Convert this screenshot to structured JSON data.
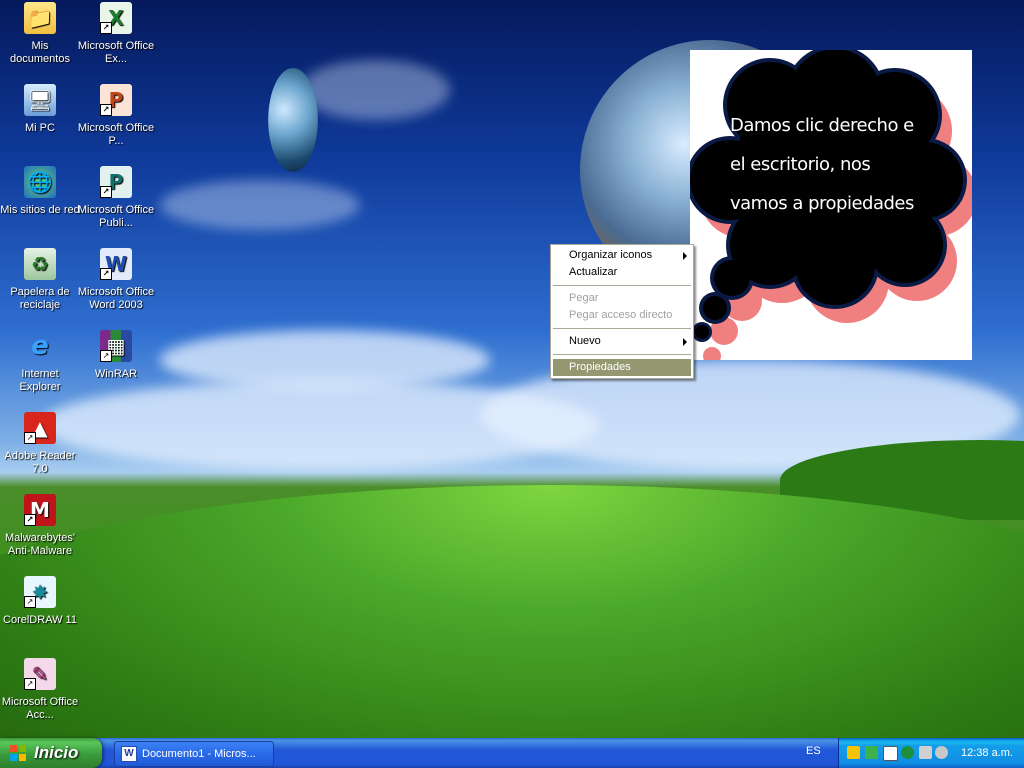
{
  "desktop": {
    "icons_left": [
      {
        "label": "Mis documentos",
        "icon": "folder-documents-icon",
        "shortcut": false
      },
      {
        "label": "Mi PC",
        "icon": "my-computer-icon",
        "shortcut": false
      },
      {
        "label": "Mis sitios de red",
        "icon": "network-places-icon",
        "shortcut": false
      },
      {
        "label": "Papelera de reciclaje",
        "icon": "recycle-bin-icon",
        "shortcut": false
      },
      {
        "label": "Internet Explorer",
        "icon": "internet-explorer-icon",
        "shortcut": false
      },
      {
        "label": "Adobe Reader 7.0",
        "icon": "adobe-reader-icon",
        "shortcut": true
      },
      {
        "label": "Malwarebytes' Anti-Malware",
        "icon": "malwarebytes-icon",
        "shortcut": true
      },
      {
        "label": "CorelDRAW 11",
        "icon": "coreldraw-icon",
        "shortcut": true
      },
      {
        "label": "Microsoft Office Acc...",
        "icon": "office-access-icon",
        "shortcut": true
      }
    ],
    "icons_right": [
      {
        "label": "Microsoft Office Ex...",
        "icon": "office-excel-icon",
        "shortcut": true
      },
      {
        "label": "Microsoft Office P...",
        "icon": "office-powerpoint-icon",
        "shortcut": true
      },
      {
        "label": "Microsoft Office Publi...",
        "icon": "office-publisher-icon",
        "shortcut": true
      },
      {
        "label": "Microsoft Office Word 2003",
        "icon": "office-word-icon",
        "shortcut": true
      },
      {
        "label": "WinRAR",
        "icon": "winrar-icon",
        "shortcut": true
      }
    ]
  },
  "context_menu": {
    "items": [
      {
        "label": "Organizar iconos",
        "submenu": true,
        "enabled": true
      },
      {
        "label": "Actualizar",
        "submenu": false,
        "enabled": true
      },
      {
        "label": "Pegar",
        "submenu": false,
        "enabled": false
      },
      {
        "label": "Pegar acceso directo",
        "submenu": false,
        "enabled": false
      },
      {
        "label": "Nuevo",
        "submenu": true,
        "enabled": true
      },
      {
        "label": "Propiedades",
        "submenu": false,
        "enabled": true,
        "selected": true
      }
    ]
  },
  "annotation": {
    "lines": [
      "Damos clic derecho e",
      "el escritorio, nos",
      "vamos a propiedades"
    ]
  },
  "taskbar": {
    "start_label": "Inicio",
    "tasks": [
      {
        "label": "Documento1 - Micros...",
        "icon": "word-doc-icon"
      }
    ],
    "language": "ES",
    "clock": "12:38 a.m."
  },
  "colors": {
    "taskbar_blue": "#2157d7",
    "start_green": "#3a9b3a",
    "tray_blue": "#0f8ce3",
    "menu_selected": "#949870",
    "bubble_black": "#000000",
    "bubble_shadow": "#f08080"
  }
}
